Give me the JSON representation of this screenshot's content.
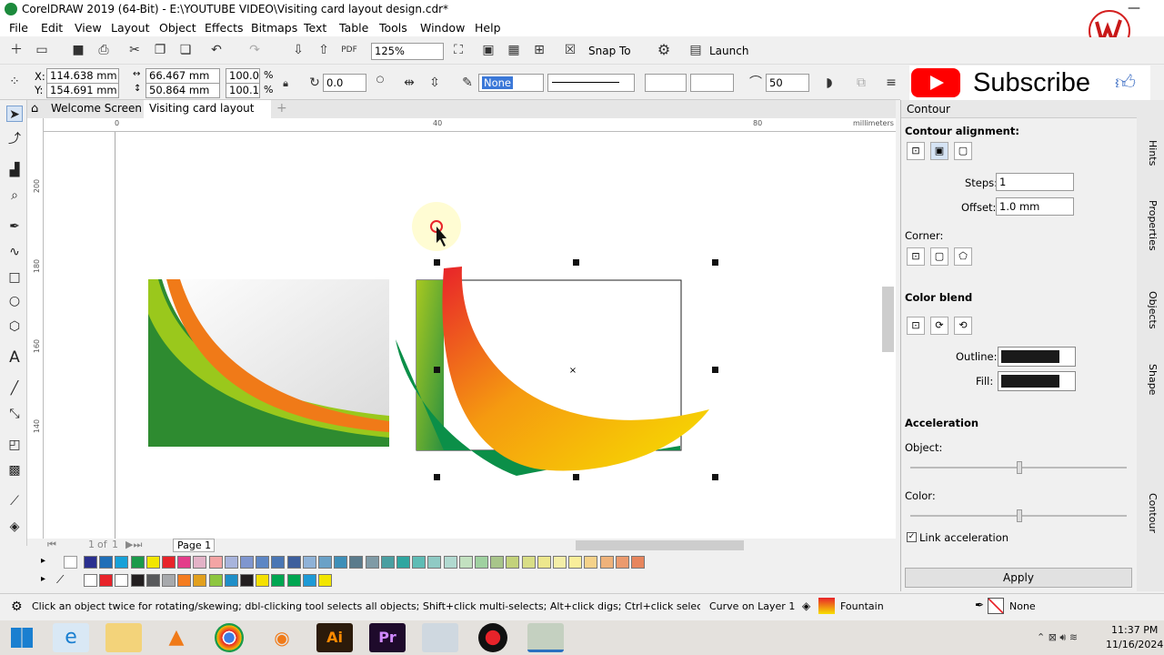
{
  "app_title": "CorelDRAW 2019 (64-Bit) - E:\\YOUTUBE VIDEO\\Visiting card layout design.cdr*",
  "menu": [
    "File",
    "Edit",
    "View",
    "Layout",
    "Object",
    "Effects",
    "Bitmaps",
    "Text",
    "Table",
    "Tools",
    "Window",
    "Help"
  ],
  "standard_toolbar": {
    "zoom": "125%",
    "snap_label": "Snap To",
    "launch_label": "Launch"
  },
  "property_bar": {
    "x_label": "X:",
    "x": "114.638 mm",
    "y_label": "Y:",
    "y": "154.691 mm",
    "w": "66.467 mm",
    "h": "50.864 mm",
    "scale_w": "100.0",
    "scale_h": "100.1",
    "percent": "%",
    "angle": "0.0",
    "fill_none": "None",
    "steps": "50"
  },
  "tabs": [
    {
      "label": "Welcome Screen"
    },
    {
      "label": "Visiting card layout d..*"
    }
  ],
  "ruler": {
    "unit": "millimeters",
    "h_ticks": [
      "0",
      "40",
      "80"
    ],
    "v_ticks": [
      "200",
      "180",
      "160",
      "140"
    ]
  },
  "page_nav": {
    "current": "1",
    "of_label": "of",
    "total": "1",
    "page_tab": "Page 1"
  },
  "palette_row1": [
    "#2a2f8f",
    "#1f6fb8",
    "#17a1d8",
    "#1a9a4a",
    "#f2e600",
    "#e8232a",
    "#e43d8a",
    "#e3b2c7",
    "#f3a4a4",
    "#a8b4dc",
    "#7f96cf",
    "#5d86c4",
    "#4a76b4",
    "#3d5f9d",
    "#8fb2d7",
    "#6aa1c7",
    "#3e8fb8",
    "#5a7b8c",
    "#7f9ba6",
    "#4a9fa1",
    "#2fa6a0",
    "#5ebcb5",
    "#8fcac4",
    "#b1d9d0",
    "#c3e1c0",
    "#9fd1a0",
    "#a8c58a",
    "#c3d27b",
    "#d9de86",
    "#ede78d",
    "#f4eea8",
    "#f9ee9a",
    "#f5d28a",
    "#efb27a",
    "#eb9a6e",
    "#e7855d"
  ],
  "palette_row2": [
    "#ffffff",
    "#e8232a",
    "#ffffff",
    "#231f20",
    "#58595b",
    "#a7a9ac",
    "#f47c20",
    "#e2a01e",
    "#8dc63f",
    "#1f8fc8",
    "#231f20",
    "#f5e100",
    "#00a651",
    "#00a651",
    "#1e9ad6",
    "#f2e600"
  ],
  "docker": {
    "title": "Contour",
    "alignment_label": "Contour alignment:",
    "steps_label": "Steps:",
    "steps_value": "1",
    "offset_label": "Offset:",
    "offset_value": "1.0 mm",
    "corner_label": "Corner:",
    "color_blend_label": "Color blend",
    "outline_label": "Outline:",
    "fill_label": "Fill:",
    "acceleration_label": "Acceleration",
    "object_label": "Object:",
    "color_label": "Color:",
    "link_label": "Link acceleration",
    "apply_label": "Apply"
  },
  "side_tabs": [
    "Hints",
    "Properties",
    "Objects",
    "Shape",
    "Contour"
  ],
  "subscribe_label": "Subscribe",
  "status": {
    "hint": "Click an object twice for rotating/skewing; dbl-clicking tool selects all objects; Shift+click multi-selects; Alt+click digs; Ctrl+click selects in a group",
    "layer": "Curve on Layer 1",
    "fill": "Fountain",
    "outline": "None"
  },
  "clock": {
    "time": "11:37 PM",
    "date": "11/16/2024"
  },
  "colors": {
    "green_dark": "#0b8f48",
    "green_light": "#a8c820",
    "orange": "#f07a18",
    "red": "#e8232a",
    "yellow": "#f5d800",
    "youtube_red": "#ff0000"
  }
}
